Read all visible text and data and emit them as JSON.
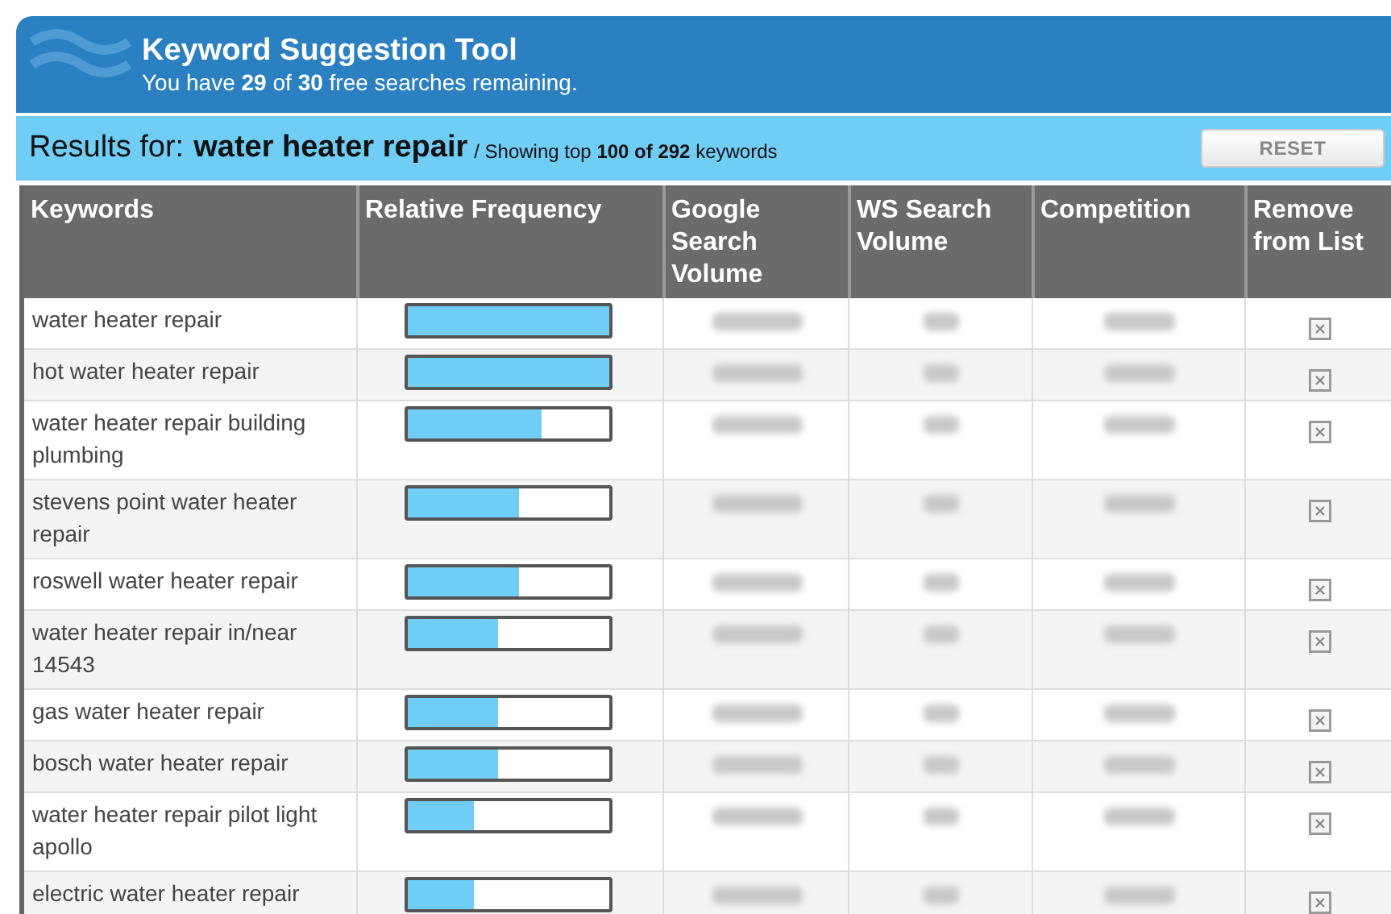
{
  "header": {
    "title": "Keyword Suggestion Tool",
    "subtitle": "You have **29** of **30** free searches remaining."
  },
  "results_bar": {
    "label": "Results for:",
    "query": "water heater repair",
    "summary": "/ Showing top **100 of 292** keywords",
    "reset_button": "RESET"
  },
  "table": {
    "columns": [
      "Keywords",
      "Relative Frequency",
      "Google Search Volume",
      "WS Search Volume",
      "Competition",
      "Remove from List"
    ],
    "rows": [
      {
        "keyword": "water heater repair",
        "level": 1.0
      },
      {
        "keyword": "hot water heater repair",
        "level": 1.0
      },
      {
        "keyword": "water heater repair building plumbing",
        "level": 0.66
      },
      {
        "keyword": "stevens point water heater repair",
        "level": 0.55
      },
      {
        "keyword": "roswell water heater repair",
        "level": 0.55
      },
      {
        "keyword": "water heater repair in/near 14543",
        "level": 0.45
      },
      {
        "keyword": "gas water heater repair",
        "level": 0.45
      },
      {
        "keyword": "bosch water heater repair",
        "level": 0.45
      },
      {
        "keyword": "water heater repair pilot light apollo",
        "level": 0.33
      },
      {
        "keyword": "electric water heater repair",
        "level": 0.33
      }
    ]
  }
}
